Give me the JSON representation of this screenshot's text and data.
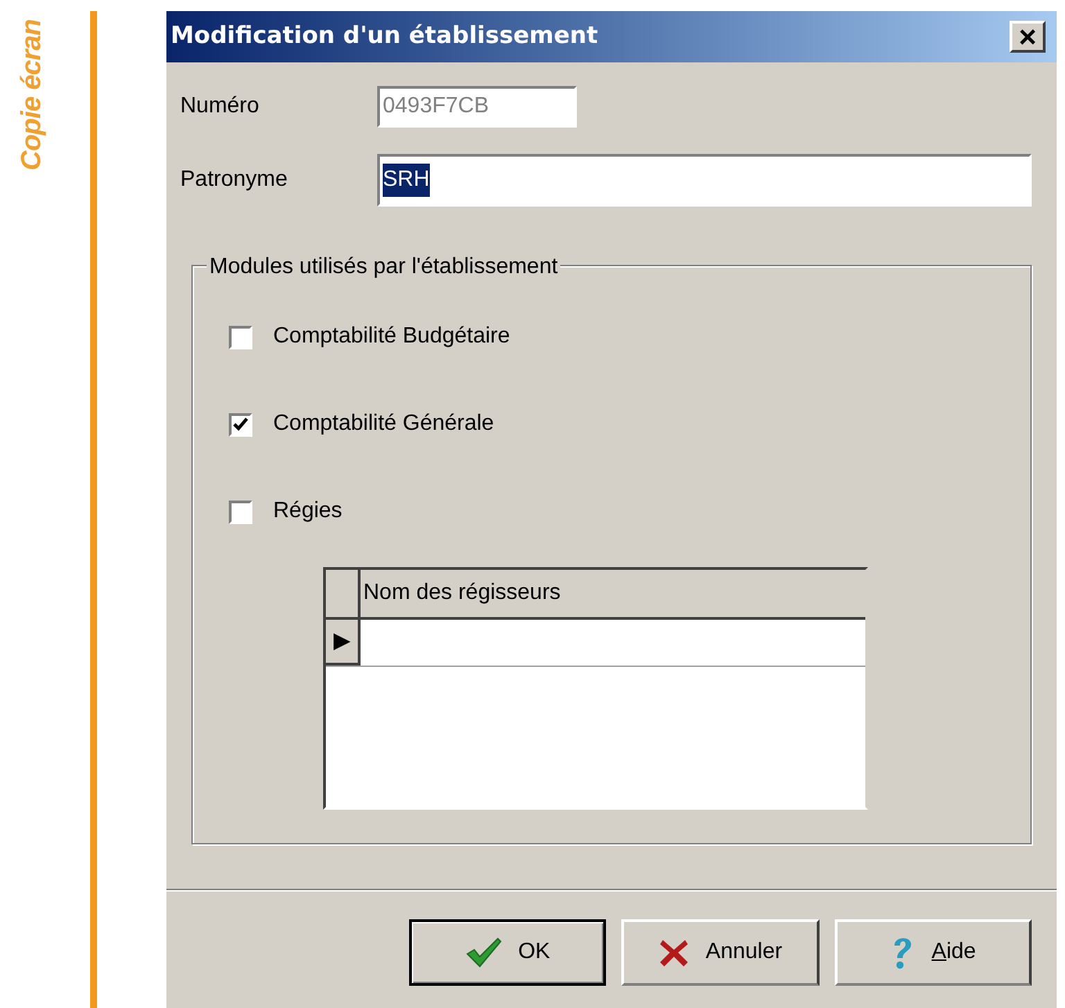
{
  "side_label": "Copie écran",
  "window": {
    "title": "Modification d'un établissement",
    "close": "×"
  },
  "fields": [
    {
      "label": "Numéro",
      "value": "0493F7CB",
      "disabled": true,
      "value_selected": false
    },
    {
      "label": "Patronyme",
      "value": "SRH",
      "disabled": false,
      "value_selected": true
    }
  ],
  "modules": {
    "legend": "Modules utilisés par l'établissement",
    "checkboxes": [
      {
        "label": "Comptabilité Budgétaire",
        "checked": false
      },
      {
        "label": "Comptabilité Générale",
        "checked": true
      },
      {
        "label": "Régies",
        "checked": false
      }
    ],
    "grid": {
      "columns": [
        "Nom des régisseurs"
      ],
      "current_row_marker": "▶"
    }
  },
  "buttons": [
    {
      "kind": "ok",
      "label": "OK",
      "default": true
    },
    {
      "kind": "cancel",
      "label": "Annuler",
      "default": false
    },
    {
      "kind": "help",
      "label": "Aide",
      "default": false,
      "mnemonic_underlined": true
    }
  ]
}
